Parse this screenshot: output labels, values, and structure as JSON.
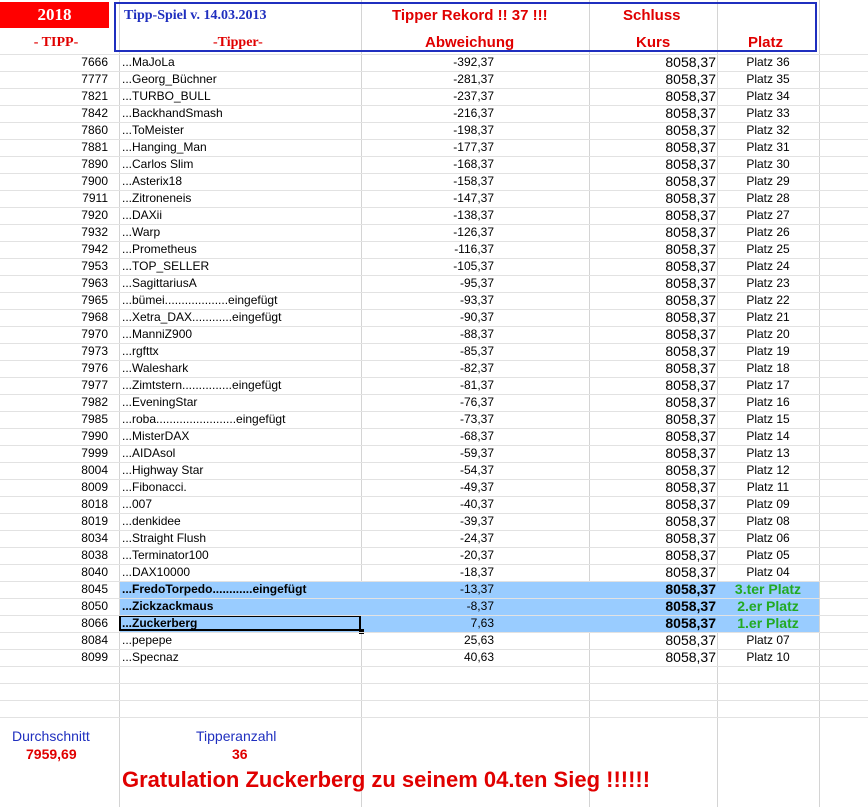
{
  "header": {
    "year": "2018",
    "title": "Tipp-Spiel v. 14.03.2013",
    "rekord": "Tipper Rekord !!  37  !!!",
    "schluss": "Schluss",
    "col_tipp": "- TIPP-",
    "col_tipper": "-Tipper-",
    "col_abweichung": "Abweichung",
    "col_kurs": "Kurs",
    "col_platz": "Platz"
  },
  "rows": [
    {
      "tipp": "7666",
      "name": "...MaJoLa",
      "abw": "-392,37",
      "kurs": "8058,37",
      "platz": "Platz 36"
    },
    {
      "tipp": "7777",
      "name": "...Georg_Büchner",
      "abw": "-281,37",
      "kurs": "8058,37",
      "platz": "Platz 35"
    },
    {
      "tipp": "7821",
      "name": "...TURBO_BULL",
      "abw": "-237,37",
      "kurs": "8058,37",
      "platz": "Platz 34"
    },
    {
      "tipp": "7842",
      "name": "...BackhandSmash",
      "abw": "-216,37",
      "kurs": "8058,37",
      "platz": "Platz 33"
    },
    {
      "tipp": "7860",
      "name": "...ToMeister",
      "abw": "-198,37",
      "kurs": "8058,37",
      "platz": "Platz 32"
    },
    {
      "tipp": "7881",
      "name": "...Hanging_Man",
      "abw": "-177,37",
      "kurs": "8058,37",
      "platz": "Platz 31"
    },
    {
      "tipp": "7890",
      "name": "...Carlos Slim",
      "abw": "-168,37",
      "kurs": "8058,37",
      "platz": "Platz 30"
    },
    {
      "tipp": "7900",
      "name": "...Asterix18",
      "abw": "-158,37",
      "kurs": "8058,37",
      "platz": "Platz 29"
    },
    {
      "tipp": "7911",
      "name": "...Zitroneneis",
      "abw": "-147,37",
      "kurs": "8058,37",
      "platz": "Platz 28"
    },
    {
      "tipp": "7920",
      "name": "...DAXii",
      "abw": "-138,37",
      "kurs": "8058,37",
      "platz": "Platz 27"
    },
    {
      "tipp": "7932",
      "name": "...Warp",
      "abw": "-126,37",
      "kurs": "8058,37",
      "platz": "Platz 26"
    },
    {
      "tipp": "7942",
      "name": "...Prometheus",
      "abw": "-116,37",
      "kurs": "8058,37",
      "platz": "Platz 25"
    },
    {
      "tipp": "7953",
      "name": "...TOP_SELLER",
      "abw": "-105,37",
      "kurs": "8058,37",
      "platz": "Platz 24"
    },
    {
      "tipp": "7963",
      "name": "...SagittariusA",
      "abw": "-95,37",
      "kurs": "8058,37",
      "platz": "Platz 23"
    },
    {
      "tipp": "7965",
      "name": "...bümei...................eingefügt",
      "abw": "-93,37",
      "kurs": "8058,37",
      "platz": "Platz 22"
    },
    {
      "tipp": "7968",
      "name": "...Xetra_DAX............eingefügt",
      "abw": "-90,37",
      "kurs": "8058,37",
      "platz": "Platz 21"
    },
    {
      "tipp": "7970",
      "name": "...ManniZ900",
      "abw": "-88,37",
      "kurs": "8058,37",
      "platz": "Platz 20"
    },
    {
      "tipp": "7973",
      "name": "...rgfttx",
      "abw": "-85,37",
      "kurs": "8058,37",
      "platz": "Platz 19"
    },
    {
      "tipp": "7976",
      "name": "...Waleshark",
      "abw": "-82,37",
      "kurs": "8058,37",
      "platz": "Platz 18"
    },
    {
      "tipp": "7977",
      "name": "...Zimtstern...............eingefügt",
      "abw": "-81,37",
      "kurs": "8058,37",
      "platz": "Platz 17"
    },
    {
      "tipp": "7982",
      "name": "...EveningStar",
      "abw": "-76,37",
      "kurs": "8058,37",
      "platz": "Platz 16"
    },
    {
      "tipp": "7985",
      "name": "...roba........................eingefügt",
      "abw": "-73,37",
      "kurs": "8058,37",
      "platz": "Platz 15"
    },
    {
      "tipp": "7990",
      "name": "...MisterDAX",
      "abw": "-68,37",
      "kurs": "8058,37",
      "platz": "Platz 14"
    },
    {
      "tipp": "7999",
      "name": "...AIDAsol",
      "abw": "-59,37",
      "kurs": "8058,37",
      "platz": "Platz 13"
    },
    {
      "tipp": "8004",
      "name": "...Highway Star",
      "abw": "-54,37",
      "kurs": "8058,37",
      "platz": "Platz 12"
    },
    {
      "tipp": "8009",
      "name": "...Fibonacci.",
      "abw": "-49,37",
      "kurs": "8058,37",
      "platz": "Platz 11"
    },
    {
      "tipp": "8018",
      "name": "...007",
      "abw": "-40,37",
      "kurs": "8058,37",
      "platz": "Platz 09"
    },
    {
      "tipp": "8019",
      "name": "...denkidee",
      "abw": "-39,37",
      "kurs": "8058,37",
      "platz": "Platz 08"
    },
    {
      "tipp": "8034",
      "name": "...Straight Flush",
      "abw": "-24,37",
      "kurs": "8058,37",
      "platz": "Platz 06"
    },
    {
      "tipp": "8038",
      "name": "...Terminator100",
      "abw": "-20,37",
      "kurs": "8058,37",
      "platz": "Platz 05"
    },
    {
      "tipp": "8040",
      "name": "...DAX10000",
      "abw": "-18,37",
      "kurs": "8058,37",
      "platz": "Platz 04"
    },
    {
      "tipp": "8045",
      "name": "...FredoTorpedo............eingefügt",
      "abw": "-13,37",
      "kurs": "8058,37",
      "platz": "3.ter Platz",
      "highlight": true
    },
    {
      "tipp": "8050",
      "name": "...Zickzackmaus",
      "abw": "-8,37",
      "kurs": "8058,37",
      "platz": "2.er Platz",
      "highlight": true
    },
    {
      "tipp": "8066",
      "name": "...Zuckerberg",
      "abw": "7,63",
      "kurs": "8058,37",
      "platz": "1.er Platz",
      "highlight": true,
      "selected": true
    },
    {
      "tipp": "8084",
      "name": "...pepepe",
      "abw": "25,63",
      "kurs": "8058,37",
      "platz": "Platz 07"
    },
    {
      "tipp": "8099",
      "name": "...Specnaz",
      "abw": "40,63",
      "kurs": "8058,37",
      "platz": "Platz 10"
    }
  ],
  "footer": {
    "durchschnitt_label": "Durchschnitt",
    "durchschnitt_value": "7959,69",
    "tipperanzahl_label": "Tipperanzahl",
    "tipperanzahl_value": "36",
    "gratulation": "Gratulation Zuckerberg  zu seinem 04.ten Sieg !!!!!!"
  },
  "colors": {
    "highlight": "#99ccff",
    "red": "#e00000",
    "blue": "#1f2fbf",
    "winner_green": "#22aa22"
  }
}
